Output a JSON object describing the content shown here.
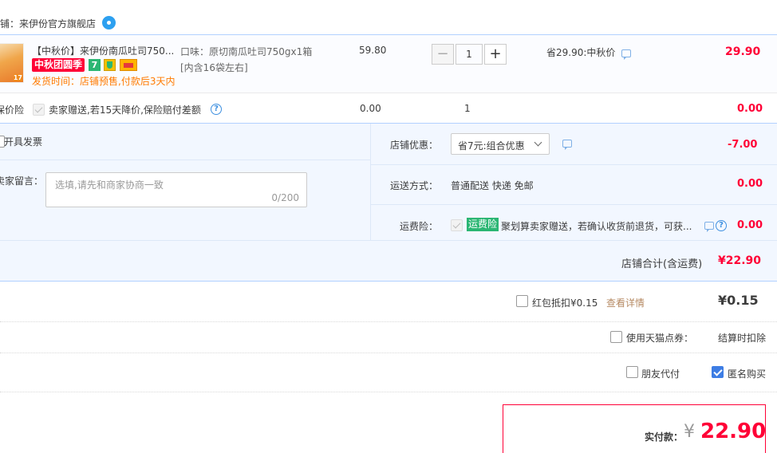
{
  "shop": {
    "label": "店铺：来伊份官方旗舰店"
  },
  "item": {
    "title": "【中秋价】来伊份南瓜吐司750...",
    "badge_main": "中秋团圆季",
    "delivery_note": "发货时间：店铺预售,付款后3天内",
    "spec_line1": "口味：原切南瓜吐司750gx1箱",
    "spec_line2": "[内含16袋左右]",
    "unit_price": "59.80",
    "qty_minus": "−",
    "qty_value": "1",
    "qty_plus": "+",
    "saving": "省29.90:中秋价",
    "subtotal": "29.90"
  },
  "protect": {
    "label": "保价险",
    "desc": "卖家赠送,若15天降价,保险赔付差额",
    "price": "0.00",
    "qty": "1",
    "amount": "0.00"
  },
  "invoice": {
    "label": "开具发票"
  },
  "message": {
    "label": "卖家留言：",
    "placeholder": "选填,请先和商家协商一致",
    "counter": "0/200"
  },
  "discount": {
    "label": "店铺优惠：",
    "selected": "省7元:组合优惠",
    "amount": "-7.00"
  },
  "shipping": {
    "label": "运送方式：",
    "value": "普通配送 快递 免邮",
    "amount": "0.00"
  },
  "freight": {
    "label": "运费险：",
    "tag": "运费险",
    "desc": "聚划算卖家赠送，若确认收货前退货，可获...",
    "amount": "0.00"
  },
  "shop_total": {
    "label": "店铺合计(含运费)",
    "value": "¥22.90"
  },
  "redpacket": {
    "label": "红包抵扣¥0.15",
    "link": "查看详情",
    "value": "¥0.15"
  },
  "tmall_points": {
    "label": "使用天猫点券：",
    "value": "结算时扣除"
  },
  "friend_pay": {
    "label": "朋友代付"
  },
  "anonymous": {
    "label": "匿名购买"
  },
  "payable": {
    "label": "实付款：",
    "currency": "¥",
    "value": "22.90"
  },
  "colors": {
    "accent": "#ff0036",
    "blue": "#3d7de4",
    "bluebg": "#f2f7ff"
  }
}
